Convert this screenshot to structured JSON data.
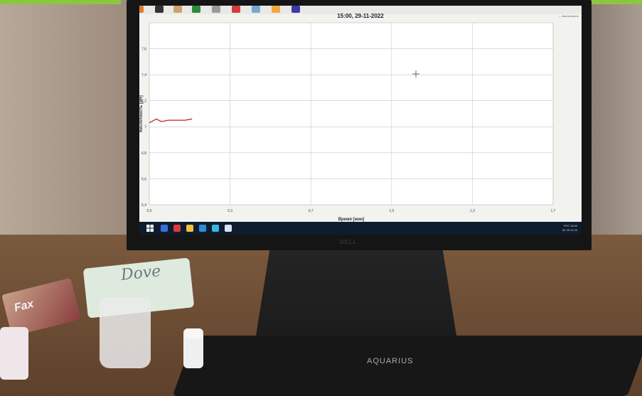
{
  "top_strip": {
    "colors": [
      "#8cc63f",
      "#ffffff"
    ]
  },
  "screen": {
    "title": "15:00, 29-11-2022",
    "legend_label": "Кислотность",
    "taskbar": {
      "language": "РУС",
      "time": "15:00",
      "date": "Вт 29.11.22"
    }
  },
  "chart_data": {
    "type": "line",
    "title": "15:00, 29-11-2022",
    "xlabel": "Время [мин]",
    "ylabel": "Кислотность [pH]",
    "xlim": [
      0,
      1.7
    ],
    "ylim": [
      6.4,
      7.8
    ],
    "x_ticks": [
      "0,0",
      "0,3",
      "0,7",
      "1,0",
      "1,3",
      "1,7"
    ],
    "y_ticks": [
      "6,4",
      "6,6",
      "6,8",
      "7",
      "7,2",
      "7,4",
      "7,6"
    ],
    "grid": true,
    "legend": "top-right",
    "series": [
      {
        "name": "Кислотность",
        "color": "#c41e2a",
        "x": [
          0.0,
          0.03,
          0.05,
          0.08,
          0.12,
          0.15,
          0.18
        ],
        "y": [
          7.03,
          7.06,
          7.04,
          7.05,
          7.05,
          7.05,
          7.06
        ]
      }
    ]
  },
  "monitor": {
    "brand": "DELL"
  },
  "keyboard": {
    "brand": "AQUARIUS"
  },
  "products": {
    "soap_1": "Dove",
    "soap_2": "Fax"
  }
}
